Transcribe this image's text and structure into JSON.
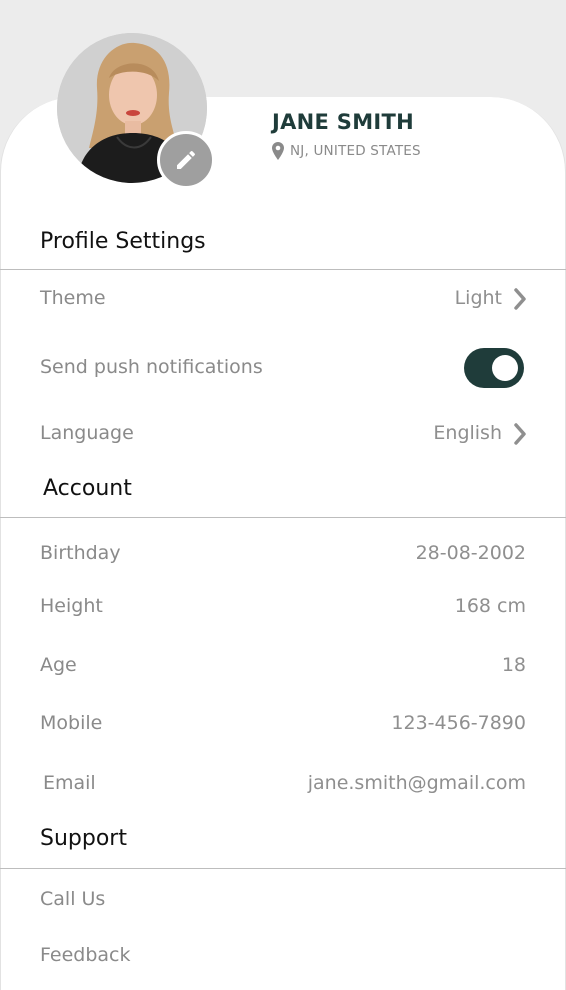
{
  "profile": {
    "name": "JANE SMITH",
    "location": "NJ, UNITED STATES"
  },
  "sections": {
    "profile_settings": "Profile Settings",
    "account": "Account",
    "support": "Support"
  },
  "settings": {
    "theme_label": "Theme",
    "theme_value": "Light",
    "push_label": "Send push notifications",
    "push_enabled": true,
    "language_label": "Language",
    "language_value": "English"
  },
  "account": {
    "birthday_label": "Birthday",
    "birthday_value": "28-08-2002",
    "height_label": "Height",
    "height_value": "168 cm",
    "age_label": "Age",
    "age_value": "18",
    "mobile_label": "Mobile",
    "mobile_value": "123-456-7890",
    "email_label": "Email",
    "email_value": "jane.smith@gmail.com"
  },
  "support": {
    "call_label": "Call Us",
    "feedback_label": "Feedback"
  },
  "colors": {
    "accent": "#1f3c3a",
    "muted_text": "#8a8a8a",
    "header_bg": "#ececec",
    "edit_button": "#9f9f9f"
  },
  "icons": {
    "edit": "pencil-icon",
    "location": "location-pin-icon",
    "chevron": "chevron-right-icon"
  }
}
